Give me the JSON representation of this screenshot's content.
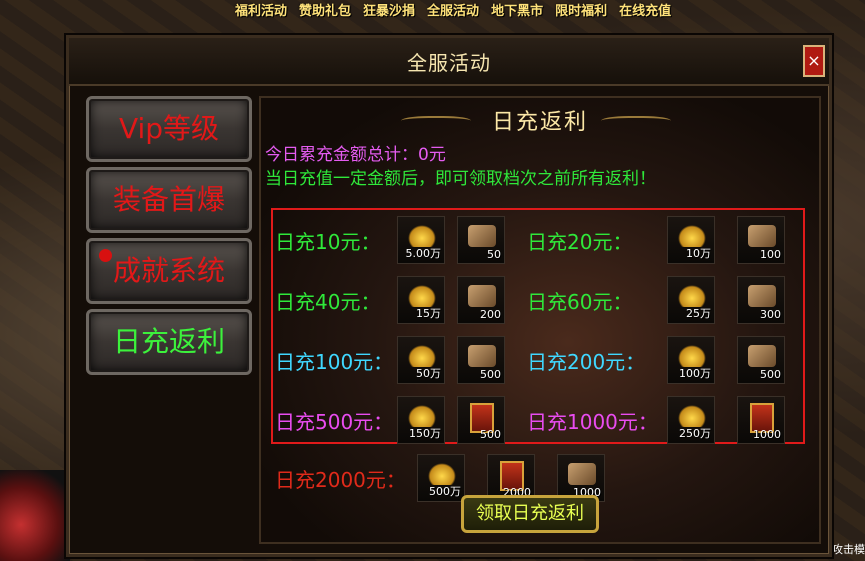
{
  "topbar": [
    "福利活动",
    "赞助礼包",
    "狂暴沙捐",
    "全服活动",
    "地下黑市",
    "限时福利",
    "在线充值"
  ],
  "window": {
    "title": "全服活动",
    "close_label": "×"
  },
  "sidebar": {
    "items": [
      {
        "label": "Vip等级",
        "color": "red"
      },
      {
        "label": "装备首爆",
        "color": "red"
      },
      {
        "label": "成就系统",
        "color": "red",
        "has_dot": true
      },
      {
        "label": "日充返利",
        "color": "green",
        "active": true
      }
    ]
  },
  "content": {
    "title": "日充返利",
    "total_text": "今日累充金额总计：0元",
    "desc_text": "当日充值一定金额后，即可领取档次之前所有返利！",
    "claim_label": "领取日充返利"
  },
  "tiers": [
    {
      "label": "日充10元：",
      "color": "#2fe83a",
      "rewards": [
        {
          "type": "gold",
          "qty": "5.00万"
        },
        {
          "type": "ingot",
          "qty": "50"
        }
      ]
    },
    {
      "label": "日充20元：",
      "color": "#2fe83a",
      "rewards": [
        {
          "type": "gold",
          "qty": "10万"
        },
        {
          "type": "ingot",
          "qty": "100"
        }
      ]
    },
    {
      "label": "日充40元：",
      "color": "#2fe83a",
      "rewards": [
        {
          "type": "gold",
          "qty": "15万"
        },
        {
          "type": "ingot",
          "qty": "200"
        }
      ]
    },
    {
      "label": "日充60元：",
      "color": "#2fe83a",
      "rewards": [
        {
          "type": "gold",
          "qty": "25万"
        },
        {
          "type": "ingot",
          "qty": "300"
        }
      ]
    },
    {
      "label": "日充100元：",
      "color": "#3fd8ff",
      "rewards": [
        {
          "type": "gold",
          "qty": "50万"
        },
        {
          "type": "ingot",
          "qty": "500"
        }
      ]
    },
    {
      "label": "日充200元：",
      "color": "#3fd8ff",
      "rewards": [
        {
          "type": "gold",
          "qty": "100万"
        },
        {
          "type": "ingot",
          "qty": "500"
        }
      ]
    },
    {
      "label": "日充500元：",
      "color": "#e94cf0",
      "rewards": [
        {
          "type": "gold",
          "qty": "150万"
        },
        {
          "type": "scroll",
          "qty": "500"
        }
      ]
    },
    {
      "label": "日充1000元：",
      "color": "#e94cf0",
      "rewards": [
        {
          "type": "gold",
          "qty": "250万"
        },
        {
          "type": "scroll",
          "qty": "1000"
        }
      ]
    },
    {
      "label": "日充2000元：",
      "color": "#e02a1a",
      "rewards": [
        {
          "type": "gold",
          "qty": "500万"
        },
        {
          "type": "scroll",
          "qty": "2000"
        },
        {
          "type": "ingot",
          "qty": "1000"
        }
      ]
    }
  ],
  "corner_text": "攻击模"
}
